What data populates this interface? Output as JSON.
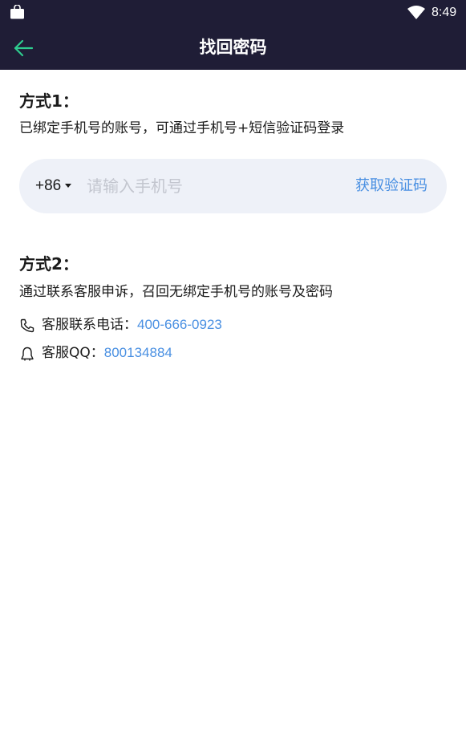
{
  "status_bar": {
    "time": "8:49",
    "icons": [
      "shopping-bag-icon",
      "wifi-icon"
    ]
  },
  "header": {
    "title": "找回密码",
    "back_icon": "arrow-left-icon",
    "back_icon_color": "#2ecc8f",
    "background": "#1f1d36"
  },
  "method1": {
    "title": "方式1：",
    "description": "已绑定手机号的账号，可通过手机号+短信验证码登录",
    "country_code": "+86",
    "phone_placeholder": "请输入手机号",
    "get_code_label": "获取验证码"
  },
  "method2": {
    "title": "方式2：",
    "description": "通过联系客服申诉，召回无绑定手机号的账号及密码",
    "phone_label": "客服联系电话：",
    "phone_value": "400-666-0923",
    "qq_label": "客服QQ：",
    "qq_value": "800134884"
  },
  "colors": {
    "accent_link": "#4a90e2",
    "input_bg": "#eef1f8"
  }
}
